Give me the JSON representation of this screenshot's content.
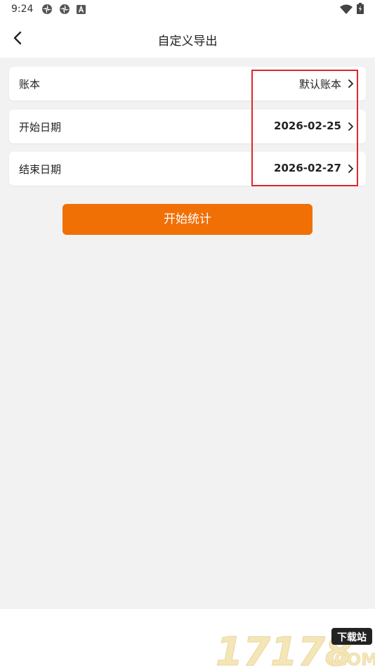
{
  "status_bar": {
    "time": "9:24",
    "left_icons": [
      "pinwheel-icon",
      "pinwheel-icon",
      "a-badge-icon"
    ],
    "right_icons": [
      "wifi-icon",
      "battery-charging-icon"
    ]
  },
  "header": {
    "title": "自定义导出",
    "back_icon": "chevron-left-icon"
  },
  "rows": [
    {
      "label": "账本",
      "value": "默认账本"
    },
    {
      "label": "开始日期",
      "value": "2026-02-25"
    },
    {
      "label": "结束日期",
      "value": "2026-02-27"
    }
  ],
  "start_button": {
    "label": "开始统计"
  },
  "watermark": {
    "digits": "17178",
    "badge": "下载站",
    "suffix": ".COM"
  },
  "colors": {
    "accent": "#f07006",
    "highlight": "#e0262c",
    "background": "#f2f2f2",
    "watermark": "#f5e6b8"
  }
}
